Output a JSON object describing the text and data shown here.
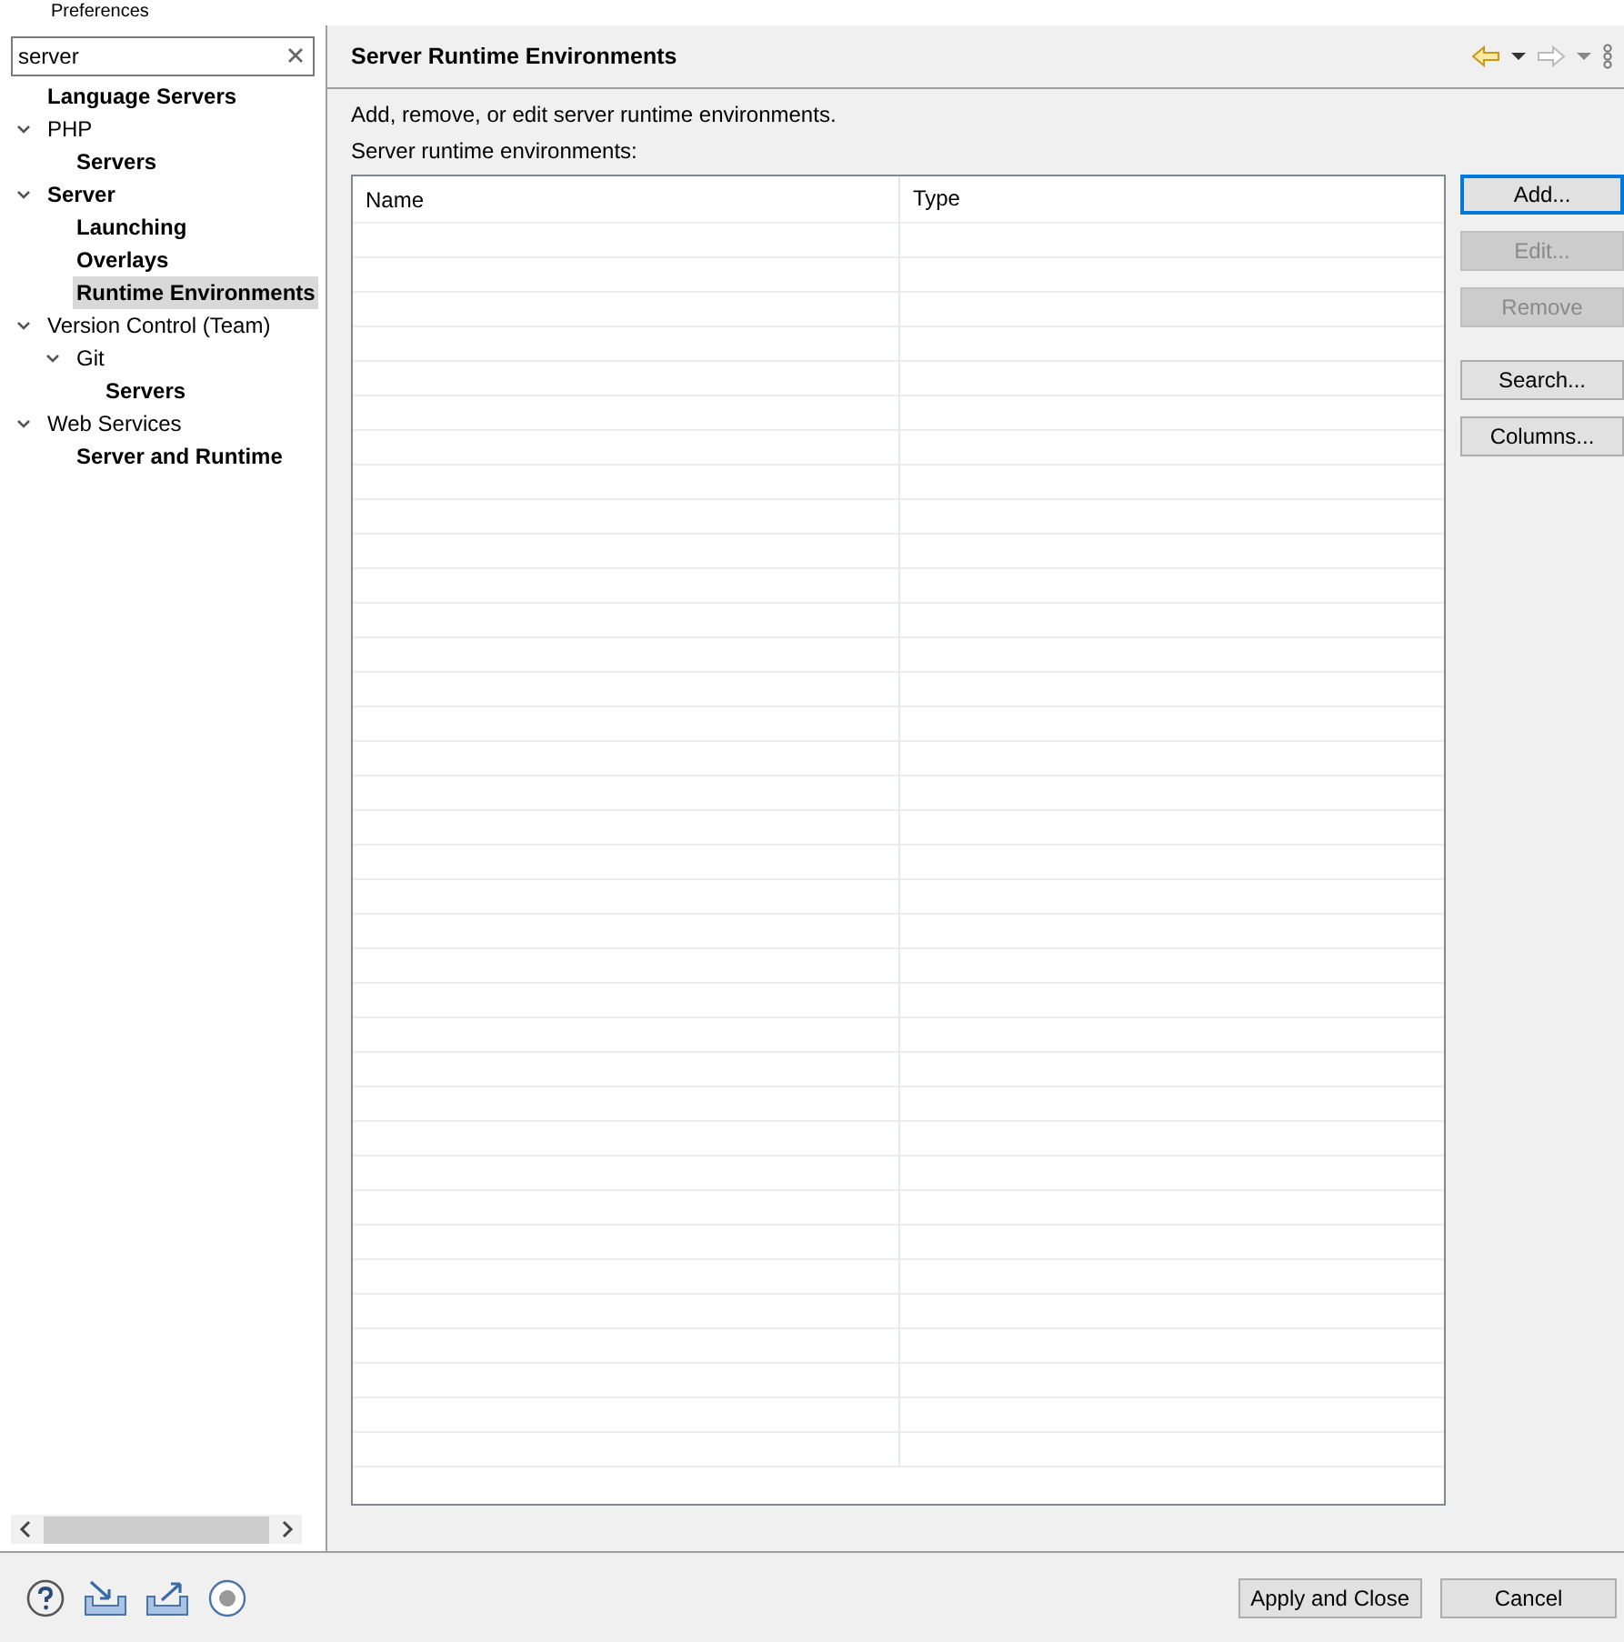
{
  "window": {
    "title": "Preferences"
  },
  "filter": {
    "value": "server"
  },
  "tree": [
    {
      "label": "Language Servers",
      "match": true,
      "selected": false
    },
    {
      "label": "PHP",
      "match": false,
      "expanded": true,
      "selected": false,
      "children": [
        {
          "label": "Servers",
          "match": true,
          "selected": false
        }
      ]
    },
    {
      "label": "Server",
      "match": true,
      "expanded": true,
      "selected": false,
      "children": [
        {
          "label": "Launching",
          "match": true,
          "selected": false
        },
        {
          "label": "Overlays",
          "match": true,
          "selected": false
        },
        {
          "label": "Runtime Environments",
          "match": true,
          "selected": true
        }
      ]
    },
    {
      "label": "Version Control (Team)",
      "match": false,
      "expanded": true,
      "selected": false,
      "children": [
        {
          "label": "Git",
          "match": false,
          "expanded": true,
          "selected": false,
          "children": [
            {
              "label": "Servers",
              "match": true,
              "selected": false
            }
          ]
        }
      ]
    },
    {
      "label": "Web Services",
      "match": false,
      "expanded": true,
      "selected": false,
      "children": [
        {
          "label": "Server and Runtime",
          "match": true,
          "selected": false
        }
      ]
    }
  ],
  "page": {
    "title": "Server Runtime Environments",
    "description": "Add, remove, or edit server runtime environments.",
    "table_label": "Server runtime environments:"
  },
  "table": {
    "columns": [
      "Name",
      "Type"
    ]
  },
  "button_groups": [
    [
      {
        "label": "Add...",
        "disabled": false,
        "focused": true
      },
      {
        "label": "Edit...",
        "disabled": true,
        "focused": false
      },
      {
        "label": "Remove",
        "disabled": true,
        "focused": false
      }
    ],
    [
      {
        "label": "Search...",
        "disabled": false,
        "focused": false
      },
      {
        "label": "Columns...",
        "disabled": false,
        "focused": false
      }
    ]
  ],
  "footer_buttons": [
    "Apply and Close",
    "Cancel"
  ]
}
